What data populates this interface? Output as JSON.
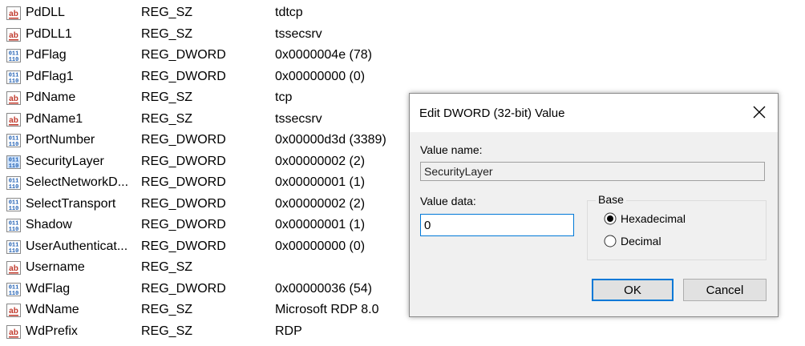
{
  "registry": {
    "values": [
      {
        "name": "PdDLL",
        "type": "REG_SZ",
        "data": "tdtcp",
        "icon": "string-value-icon"
      },
      {
        "name": "PdDLL1",
        "type": "REG_SZ",
        "data": "tssecsrv",
        "icon": "string-value-icon"
      },
      {
        "name": "PdFlag",
        "type": "REG_DWORD",
        "data": "0x0000004e (78)",
        "icon": "binary-value-icon"
      },
      {
        "name": "PdFlag1",
        "type": "REG_DWORD",
        "data": "0x00000000 (0)",
        "icon": "binary-value-icon"
      },
      {
        "name": "PdName",
        "type": "REG_SZ",
        "data": "tcp",
        "icon": "string-value-icon"
      },
      {
        "name": "PdName1",
        "type": "REG_SZ",
        "data": "tssecsrv",
        "icon": "string-value-icon"
      },
      {
        "name": "PortNumber",
        "type": "REG_DWORD",
        "data": "0x00000d3d (3389)",
        "icon": "binary-value-icon"
      },
      {
        "name": "SecurityLayer",
        "type": "REG_DWORD",
        "data": "0x00000002 (2)",
        "icon": "binary-value-icon",
        "selected": true
      },
      {
        "name": "SelectNetworkD...",
        "type": "REG_DWORD",
        "data": "0x00000001 (1)",
        "icon": "binary-value-icon"
      },
      {
        "name": "SelectTransport",
        "type": "REG_DWORD",
        "data": "0x00000002 (2)",
        "icon": "binary-value-icon"
      },
      {
        "name": "Shadow",
        "type": "REG_DWORD",
        "data": "0x00000001 (1)",
        "icon": "binary-value-icon"
      },
      {
        "name": "UserAuthenticat...",
        "type": "REG_DWORD",
        "data": "0x00000000 (0)",
        "icon": "binary-value-icon"
      },
      {
        "name": "Username",
        "type": "REG_SZ",
        "data": "",
        "icon": "string-value-icon"
      },
      {
        "name": "WdFlag",
        "type": "REG_DWORD",
        "data": "0x00000036 (54)",
        "icon": "binary-value-icon"
      },
      {
        "name": "WdName",
        "type": "REG_SZ",
        "data": "Microsoft RDP 8.0",
        "icon": "string-value-icon"
      },
      {
        "name": "WdPrefix",
        "type": "REG_SZ",
        "data": "RDP",
        "icon": "string-value-icon"
      }
    ]
  },
  "dialog": {
    "title": "Edit DWORD (32-bit) Value",
    "value_name_label": "Value name:",
    "value_name": "SecurityLayer",
    "value_data_label": "Value data:",
    "value_data": "0",
    "base_label": "Base",
    "hex_label": "Hexadecimal",
    "dec_label": "Decimal",
    "base_selected": "hexadecimal",
    "ok_label": "OK",
    "cancel_label": "Cancel"
  },
  "colors": {
    "string_icon": "#c0392b",
    "binary_icon": "#1f5fb3",
    "focus_border": "#0078d7",
    "dialog_body": "#f0f0f0"
  }
}
